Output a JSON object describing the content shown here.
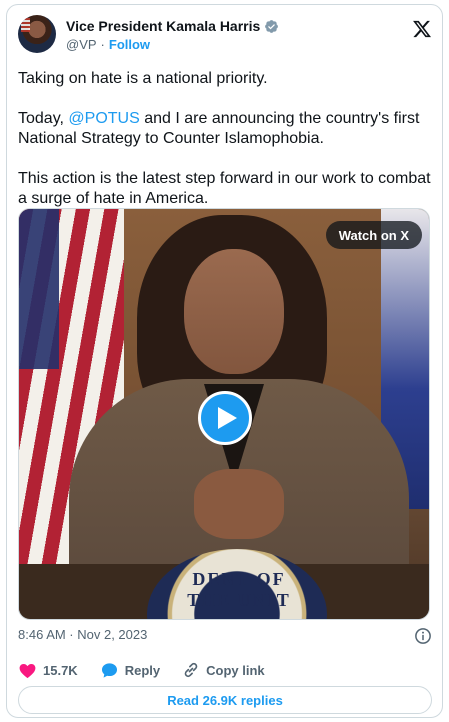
{
  "header": {
    "name": "Vice President Kamala Harris",
    "handle": "@VP",
    "separator": "·",
    "follow_label": "Follow"
  },
  "tweet": {
    "p1": "Taking on hate is a national priority.",
    "p2_before": "Today, ",
    "p2_mention": "@POTUS",
    "p2_after": " and I are announcing the country's first National Strategy to Counter Islamophobia.",
    "p3": "This action is the latest step forward in our work to combat a surge of hate in America."
  },
  "media": {
    "watch_label": "Watch on X",
    "seal_text": "DENT OF THE UNIT"
  },
  "meta": {
    "timestamp": "8:46 AM · Nov 2, 2023"
  },
  "actions": {
    "likes": "15.7K",
    "reply_label": "Reply",
    "copy_link_label": "Copy link"
  },
  "replies_button": "Read 26.9K replies",
  "colors": {
    "accent": "#1d9bf0",
    "like": "#f91880",
    "text": "#0f1419",
    "muted": "#536471",
    "border": "#cfd9de"
  },
  "icons": [
    "verified-badge-icon",
    "x-logo-icon",
    "play-icon",
    "info-icon",
    "heart-icon",
    "reply-bubble-icon",
    "link-icon"
  ]
}
